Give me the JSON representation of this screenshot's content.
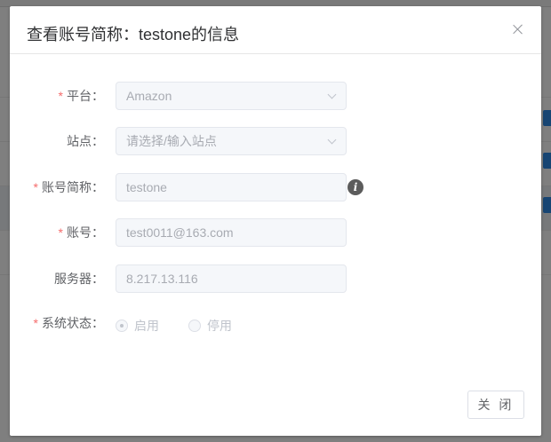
{
  "dialog": {
    "title": "查看账号简称：testone的信息",
    "close_label": "关 闭"
  },
  "form": {
    "platform": {
      "label": "平台：",
      "required": true,
      "value": "Amazon"
    },
    "site": {
      "label": "站点：",
      "required": false,
      "placeholder": "请选择/输入站点"
    },
    "account_alias": {
      "label": "账号简称：",
      "required": true,
      "value": "testone"
    },
    "account": {
      "label": "账号：",
      "required": true,
      "value": "test0011@163.com"
    },
    "server": {
      "label": "服务器：",
      "required": false,
      "value": "8.217.13.116"
    },
    "status": {
      "label": "系统状态：",
      "required": true,
      "options": [
        {
          "label": "启用",
          "selected": true
        },
        {
          "label": "停用",
          "selected": false
        }
      ]
    }
  },
  "icons": {
    "close": "close-icon",
    "info": "info-icon",
    "dropdown": "chevron-down-icon"
  }
}
